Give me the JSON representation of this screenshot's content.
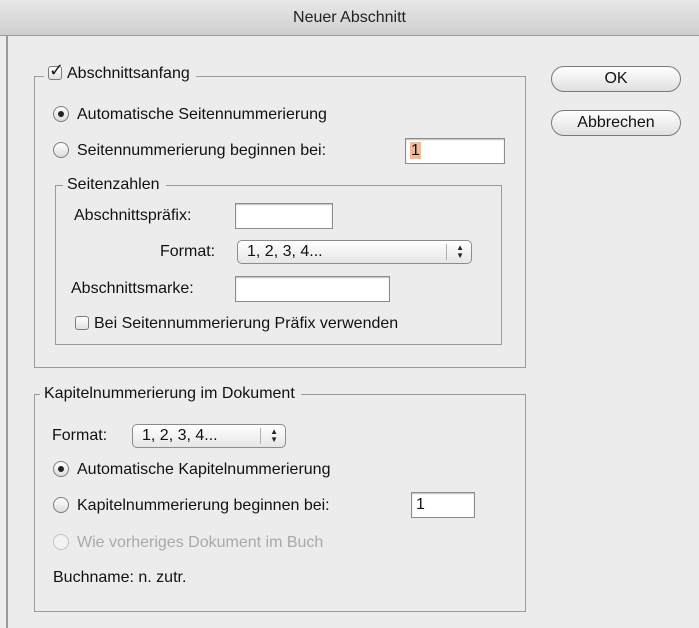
{
  "window": {
    "title": "Neuer Abschnitt"
  },
  "buttons": {
    "ok": "OK",
    "cancel": "Abbrechen"
  },
  "section_start": {
    "label": "Abschnittsanfang",
    "checked": true,
    "auto_numbering": "Automatische Seitennummerierung",
    "start_numbering_at": "Seitennummerierung beginnen bei:",
    "start_value": "1",
    "page_numbers": {
      "label": "Seitenzahlen",
      "prefix_label": "Abschnittspräfix:",
      "prefix_value": "",
      "format_label": "Format:",
      "format_value": "1, 2, 3, 4...",
      "marker_label": "Abschnittsmarke:",
      "marker_value": "",
      "use_prefix_label": "Bei Seitennummerierung Präfix verwenden"
    }
  },
  "chapter": {
    "label": "Kapitelnummerierung im Dokument",
    "format_label": "Format:",
    "format_value": "1, 2, 3, 4...",
    "auto_numbering": "Automatische Kapitelnummerierung",
    "start_numbering_at": "Kapitelnummerierung beginnen bei:",
    "start_value": "1",
    "same_as_previous": "Wie vorheriges Dokument im Buch",
    "book_name": "Buchname: n. zutr."
  },
  "icons": {
    "checkbox_checked": "checkmark-icon",
    "select_arrows": "updown-arrows-icon"
  }
}
